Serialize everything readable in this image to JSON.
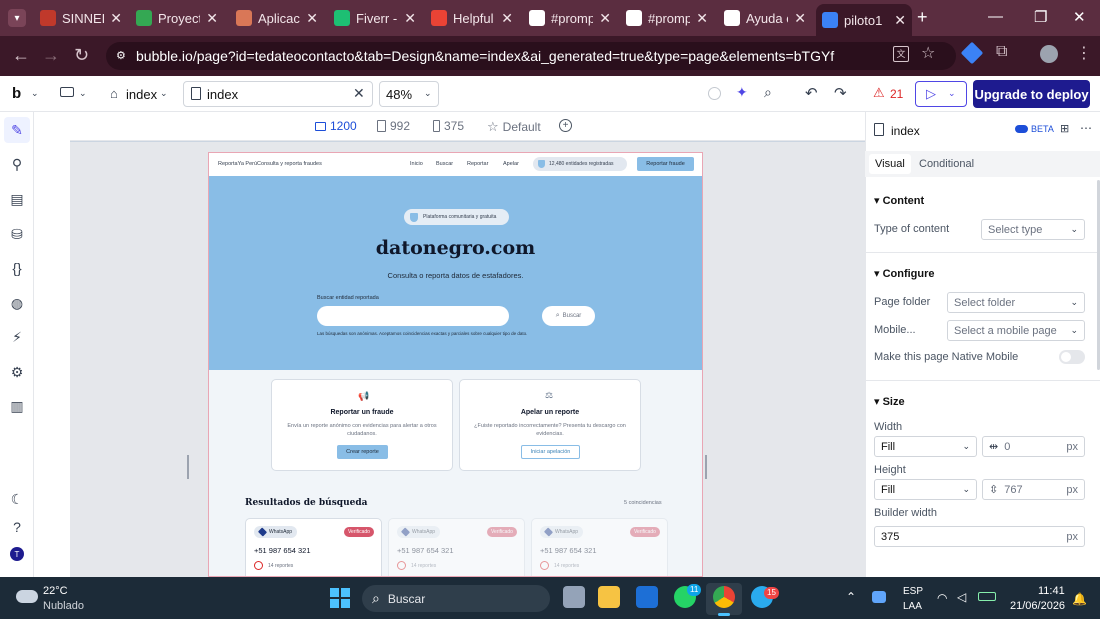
{
  "browser": {
    "tabs": [
      {
        "label": "SINNER",
        "icon": "university-crest-icon",
        "color": "#c0392b"
      },
      {
        "label": "Proyecto",
        "icon": "google-drive-icon",
        "color": "#34a853"
      },
      {
        "label": "Aplicacio",
        "icon": "claude-icon",
        "color": "#d97757"
      },
      {
        "label": "Fiverr - ",
        "icon": "fiverr-icon",
        "color": "#1dbf73"
      },
      {
        "label": "Helpful",
        "icon": "gmail-icon",
        "color": "#ea4335"
      },
      {
        "label": "#promp",
        "icon": "sparkle-icon",
        "color": "#ffffff"
      },
      {
        "label": "#promp",
        "icon": "sparkle-icon",
        "color": "#ffffff"
      },
      {
        "label": "Ayuda c",
        "icon": "openai-icon",
        "color": "#ffffff"
      },
      {
        "label": "piloto1",
        "icon": "bubble-icon",
        "color": "#3b82f6"
      }
    ],
    "url": "bubble.io/page?id=tedateocontacto&tab=Design&name=index&ai_generated=true&type=page&elements=bTGYf"
  },
  "toolbar": {
    "logo": "b",
    "page_name": "index",
    "page_select": "index",
    "zoom": "48%",
    "issues_count": "21",
    "deploy_label": "Upgrade to deploy"
  },
  "canvas": {
    "breakpoints": [
      {
        "label": "1200",
        "icon": "monitor-icon"
      },
      {
        "label": "992",
        "icon": "tablet-icon"
      },
      {
        "label": "375",
        "icon": "phone-icon"
      },
      {
        "label": "Default",
        "icon": "star-icon"
      }
    ]
  },
  "preview": {
    "nav": {
      "brand": "ReportaYa PerúConsulta y reporta fraudes",
      "links": [
        "Inicio",
        "Buscar",
        "Reportar",
        "Apelar"
      ],
      "badge": "12,480 entidades registradas",
      "cta": "Reportar fraude"
    },
    "hero": {
      "pill": "Plataforma comunitaria y gratuita",
      "title": "datonegro.com",
      "subtitle": "Consulta o reporta datos de estafadores.",
      "search_label": "Buscar entidad reportada",
      "search_button": "Buscar",
      "note": "Las búsquedas son anónimas. Aceptamos coincidencias exactas y parciales sobre cualquier tipo de dato."
    },
    "cards": [
      {
        "title": "Reportar un fraude",
        "text": "Envía un reporte anónimo con evidencias para alertar a otros ciudadanos.",
        "button": "Crear reporte"
      },
      {
        "title": "Apelar un reporte",
        "text": "¿Fuiste reportado incorrectamente? Presenta tu descargo con evidencias.",
        "button": "Iniciar apelación"
      }
    ],
    "results": {
      "title": "Resultados de búsqueda",
      "count": "5 coincidencias",
      "items": [
        {
          "channel": "WhatsApp",
          "status": "Verificado",
          "phone": "+51 987 654 321",
          "reports": "14 reportes"
        },
        {
          "channel": "WhatsApp",
          "status": "Verificado",
          "phone": "+51 987 654 321",
          "reports": "14 reportes"
        },
        {
          "channel": "WhatsApp",
          "status": "Verificado",
          "phone": "+51 987 654 321",
          "reports": "14 reportes"
        }
      ]
    }
  },
  "panel": {
    "title": "index",
    "beta": "BETA",
    "tabs": [
      "Visual",
      "Conditional"
    ],
    "content": {
      "heading": "Content",
      "type_label": "Type of content",
      "type_value": "Select type"
    },
    "configure": {
      "heading": "Configure",
      "folder_label": "Page folder",
      "folder_value": "Select folder",
      "mobile_label": "Mobile...",
      "mobile_value": "Select a mobile page",
      "native_label": "Make this page Native Mobile"
    },
    "size": {
      "heading": "Size",
      "width_label": "Width",
      "width_mode": "Fill",
      "width_value": "0",
      "height_label": "Height",
      "height_mode": "Fill",
      "height_value": "767",
      "builder_label": "Builder width",
      "builder_value": "375",
      "unit": "px"
    }
  },
  "taskbar": {
    "weather_temp": "22°C",
    "weather_desc": "Nublado",
    "search": "Buscar",
    "lang1": "ESP",
    "lang2": "LAA",
    "time": "11:41",
    "date": "21/06/2026",
    "badge_whatsapp": "11",
    "badge_telegram": "15"
  }
}
